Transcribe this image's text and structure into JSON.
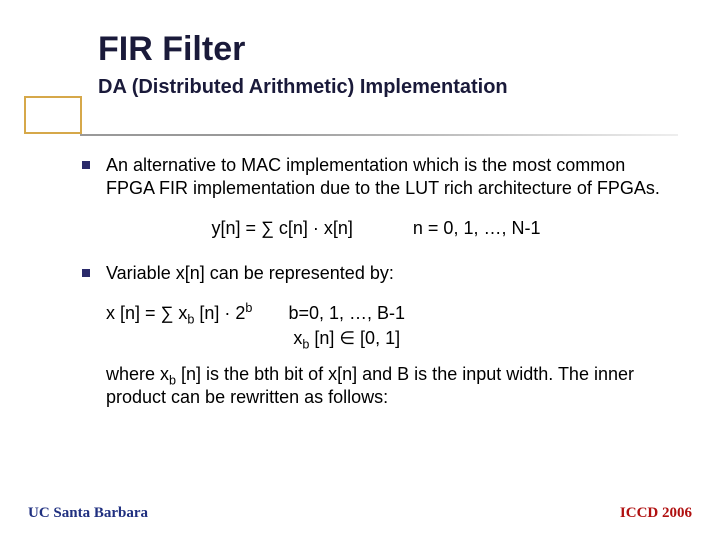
{
  "header": {
    "title": "FIR Filter",
    "subtitle": "DA (Distributed Arithmetic) Implementation"
  },
  "body": {
    "bullet1": "An alternative to MAC implementation which is the most common FPGA FIR implementation due to the LUT rich architecture of FPGAs.",
    "eq1_left": "y[n] = ∑ c[n] · x[n]",
    "eq1_right": "n = 0, 1, …, N-1",
    "bullet2": "Variable x[n] can be represented by:",
    "eq2_left_prefix": "x [n] = ∑ x",
    "eq2_left_sub": "b",
    "eq2_left_mid": " [n] · 2",
    "eq2_left_sup": "b",
    "eq2_right_line1": "b=0, 1, …, B-1",
    "eq2_right_line2_prefix": "x",
    "eq2_right_line2_sub": "b",
    "eq2_right_line2_rest": " [n]  ∈ [0, 1]",
    "after_prefix": "where x",
    "after_sub": "b",
    "after_rest": " [n] is the bth bit of x[n] and B is the input width. The inner product can be rewritten as follows:"
  },
  "footer": {
    "left": "UC Santa Barbara",
    "right": "ICCD 2006"
  }
}
